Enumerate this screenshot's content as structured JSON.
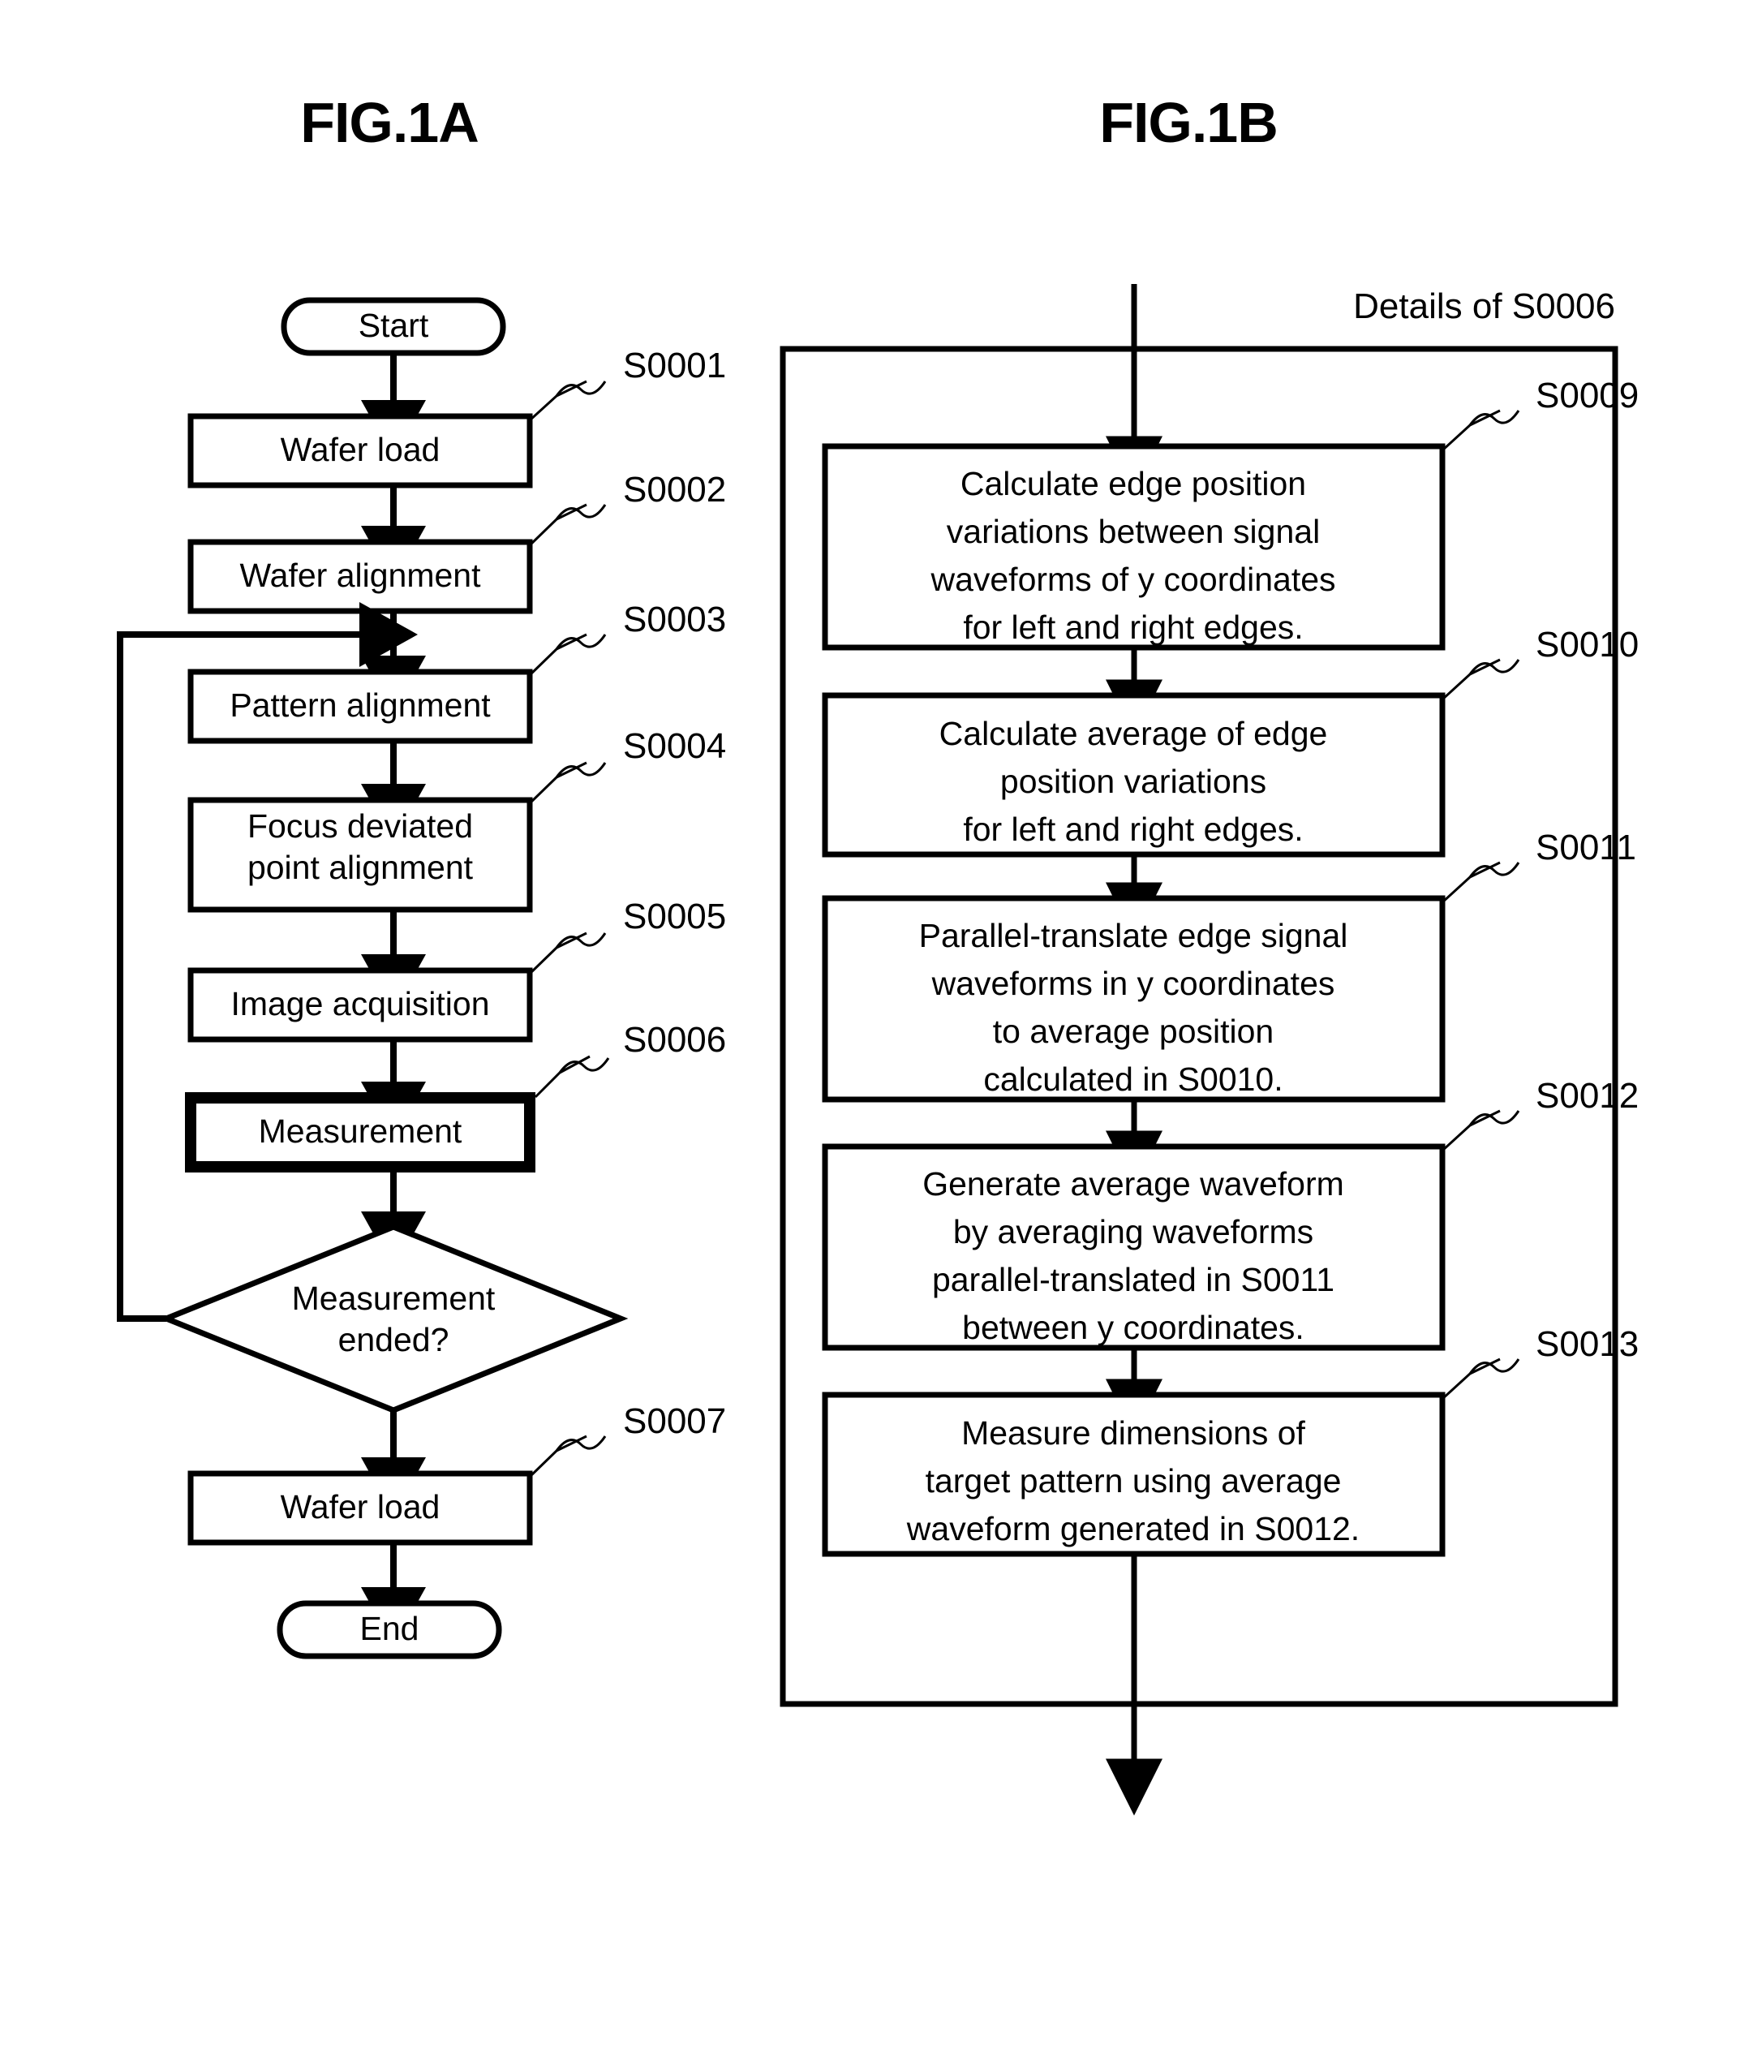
{
  "figures": [
    {
      "id": "fig-1a",
      "title": "FIG.1A",
      "nodes": [
        {
          "key": "start",
          "shape": "terminator",
          "label": "Start",
          "step": ""
        },
        {
          "key": "wafer-load",
          "shape": "process",
          "label": "Wafer load",
          "step": "S0001"
        },
        {
          "key": "wafer-alignment",
          "shape": "process",
          "label": "Wafer alignment",
          "step": "S0002"
        },
        {
          "key": "pattern-alignment",
          "shape": "process",
          "label": "Pattern alignment",
          "step": "S0003"
        },
        {
          "key": "focus-deviated",
          "shape": "process",
          "label": "Focus deviated\npoint alignment",
          "step": "S0004"
        },
        {
          "key": "image-acquisition",
          "shape": "process",
          "label": "Image acquisition",
          "step": "S0005"
        },
        {
          "key": "measurement",
          "shape": "process-emphasis",
          "label": "Measurement",
          "step": "S0006"
        },
        {
          "key": "measurement-ended",
          "shape": "decision",
          "label": "Measurement\nended?",
          "step": ""
        },
        {
          "key": "wafer-load-2",
          "shape": "process",
          "label": "Wafer load",
          "step": "S0007"
        },
        {
          "key": "end",
          "shape": "terminator",
          "label": "End",
          "step": ""
        }
      ],
      "loop_back_note": "Loop from decision back to pattern alignment"
    },
    {
      "id": "fig-1b",
      "title": "FIG.1B",
      "group_label": "Details of S0006",
      "nodes": [
        {
          "key": "calc-edge-variations",
          "shape": "process",
          "step": "S0009",
          "label": "Calculate edge position\nvariations between signal\nwaveforms of y coordinates\nfor left and right edges."
        },
        {
          "key": "calc-average",
          "shape": "process",
          "step": "S0010",
          "label": "Calculate average of edge\nposition variations\nfor left and right edges."
        },
        {
          "key": "parallel-translate",
          "shape": "process",
          "step": "S0011",
          "label": "Parallel-translate edge signal\nwaveforms in y coordinates\nto average position\ncalculated in S0010."
        },
        {
          "key": "generate-average",
          "shape": "process",
          "step": "S0012",
          "label": "Generate average waveform\nby averaging waveforms\nparallel-translated in S0011\nbetween y coordinates."
        },
        {
          "key": "measure-dimensions",
          "shape": "process",
          "step": "S0013",
          "label": "Measure dimensions of\ntarget pattern using average\nwaveform generated in S0012."
        }
      ]
    }
  ],
  "colors": {
    "stroke": "#000000",
    "fill": "#ffffff",
    "text": "#000000"
  }
}
